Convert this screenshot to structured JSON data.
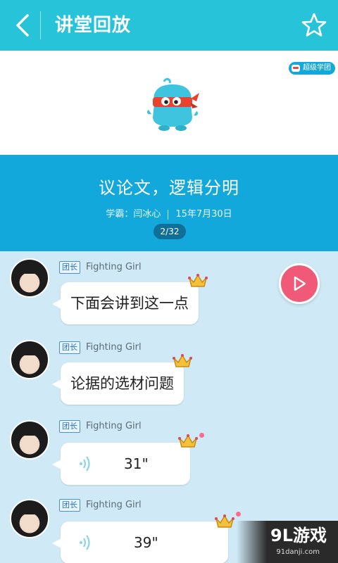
{
  "header": {
    "title": "讲堂回放",
    "back_icon": "chevron-left-icon",
    "favorite_icon": "star-outline-icon"
  },
  "banner": {
    "badge_label": "超级学团"
  },
  "lesson": {
    "title": "议论文，逻辑分明",
    "teacher": "学霸：闫冰心",
    "date": "15年7月30日",
    "page": "2/32"
  },
  "messages": [
    {
      "role": "团长",
      "user": "Fighting Girl",
      "type": "text",
      "text": "下面会讲到这一点"
    },
    {
      "role": "团长",
      "user": "Fighting Girl",
      "type": "text",
      "text": "论据的选材问题"
    },
    {
      "role": "团长",
      "user": "Fighting Girl",
      "type": "voice",
      "duration": "31\""
    },
    {
      "role": "团长",
      "user": "Fighting Girl",
      "type": "voice",
      "duration": "39\""
    }
  ],
  "play_button": {
    "icon": "play-icon"
  },
  "watermark": {
    "logo": "9L游戏",
    "url": "91danji.com"
  },
  "colors": {
    "topbar": "#27c3d9",
    "info_panel": "#12a8dc",
    "feed_bg": "#cfeaf6",
    "play_button": "#f05a78",
    "role_tag": "#2a73c8"
  }
}
